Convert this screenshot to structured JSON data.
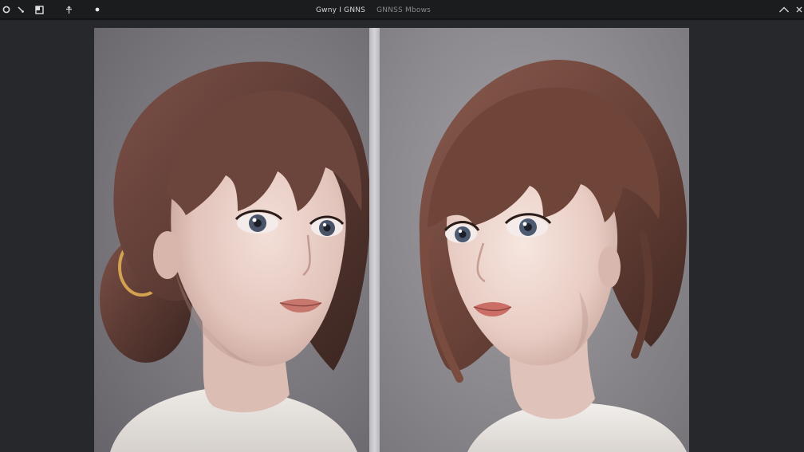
{
  "window": {
    "title": "Gwny I GNNS",
    "subtitle": "GNNSS Mbows"
  },
  "toolbar": {
    "left_icons": [
      "record-dot-icon",
      "brush-tool-icon",
      "layer-square-icon",
      "move-arrow-icon",
      "small-dot-icon"
    ],
    "right_icons": [
      "chevron-up-icon",
      "close-icon"
    ]
  },
  "canvas": {
    "background": "#27282b",
    "panel_left_bg": "#7a777d",
    "panel_right_bg": "#8b898d",
    "separator_color": "#cfcfd2"
  }
}
